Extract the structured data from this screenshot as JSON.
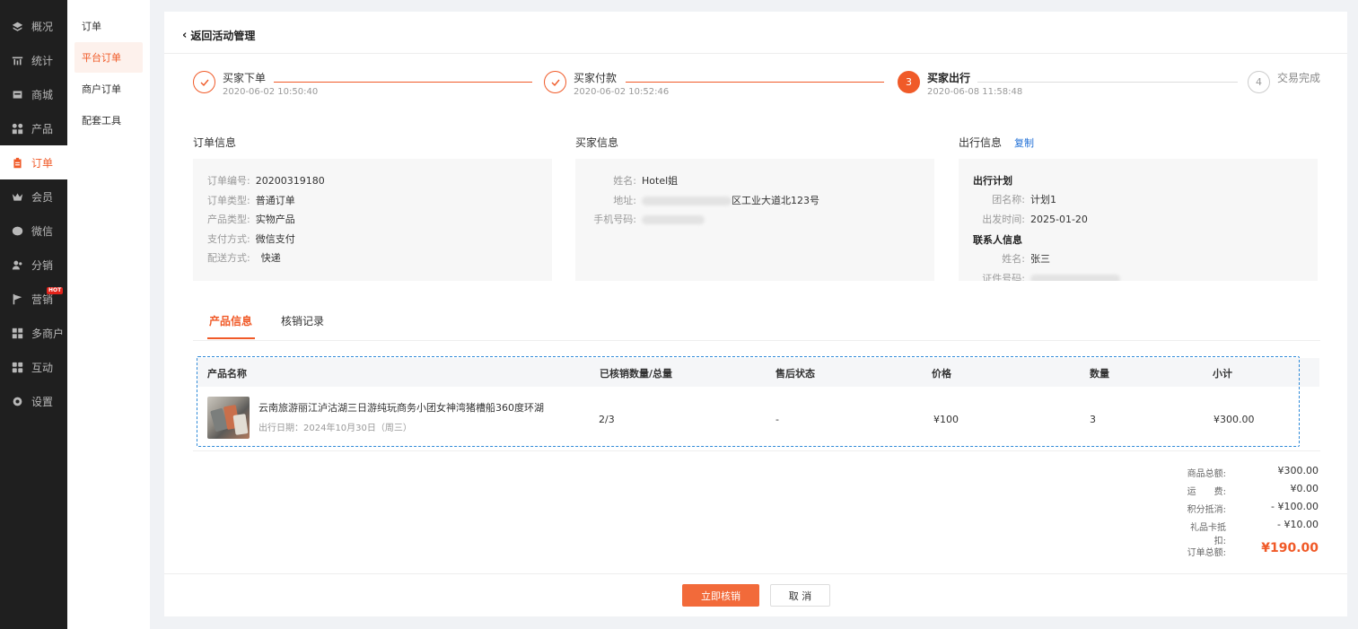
{
  "nav": [
    {
      "label": "概况",
      "icon": "layers-icon"
    },
    {
      "label": "统计",
      "icon": "chart-icon"
    },
    {
      "label": "商城",
      "icon": "store-icon"
    },
    {
      "label": "产品",
      "icon": "grid-icon"
    },
    {
      "label": "订单",
      "icon": "clipboard-icon",
      "active": true
    },
    {
      "label": "会员",
      "icon": "crown-icon"
    },
    {
      "label": "微信",
      "icon": "wechat-icon"
    },
    {
      "label": "分销",
      "icon": "users-icon"
    },
    {
      "label": "营销",
      "icon": "flag-icon",
      "badge": "HOT"
    },
    {
      "label": "多商户",
      "icon": "shop-icon"
    },
    {
      "label": "互动",
      "icon": "apps-icon"
    },
    {
      "label": "设置",
      "icon": "gear-icon"
    }
  ],
  "subnav": [
    {
      "label": "订单"
    },
    {
      "label": "平台订单",
      "active": true
    },
    {
      "label": "商户订单"
    },
    {
      "label": "配套工具"
    }
  ],
  "back_label": "返回活动管理",
  "steps": [
    {
      "title": "买家下单",
      "time": "2020-06-02 10:50:40"
    },
    {
      "title": "买家付款",
      "time": "2020-06-02 10:52:46"
    },
    {
      "num": "3",
      "title": "买家出行",
      "time": "2020-06-08 11:58:48"
    },
    {
      "num": "4",
      "title": "交易完成",
      "time": ""
    }
  ],
  "order_info": {
    "title": "订单信息",
    "rows": [
      {
        "k": "订单编号:",
        "v": "20200319180"
      },
      {
        "k": "订单类型:",
        "v": "普通订单"
      },
      {
        "k": "产品类型:",
        "v": "实物产品"
      },
      {
        "k": "支付方式:",
        "v": "微信支付"
      },
      {
        "k": "配送方式:",
        "v": "快递"
      }
    ]
  },
  "buyer_info": {
    "title": "买家信息",
    "name_k": "姓名:",
    "name_v": "Hotel姐",
    "addr_k": "地址:",
    "addr_v": "区工业大道北123号",
    "phone_k": "手机号码:"
  },
  "travel_info": {
    "title": "出行信息",
    "copy": "复制",
    "plan_head": "出行计划",
    "group_k": "团名称:",
    "group_v": "计划1",
    "depart_k": "出发时间:",
    "depart_v": "2025-01-20",
    "contact_head": "联系人信息",
    "cname_k": "姓名:",
    "cname_v": "张三",
    "idno_k": "证件号码:"
  },
  "tabs": [
    "产品信息",
    "核销记录"
  ],
  "table": {
    "headers": [
      "产品名称",
      "已核销数量/总量",
      "售后状态",
      "价格",
      "数量",
      "小计"
    ],
    "row": {
      "name": "云南旅游丽江泸沽湖三日游纯玩商务小团女神湾猪槽船360度环湖",
      "date": "出行日期：2024年10月30日（周三）",
      "verified": "2/3",
      "aftersale": "-",
      "price": "¥100",
      "qty": "3",
      "subtotal": "¥300.00"
    }
  },
  "totals": [
    {
      "k": "商品总额:",
      "v": "¥300.00"
    },
    {
      "k": "运　　费:",
      "v": "¥0.00"
    },
    {
      "k": "积分抵消:",
      "v": "- ¥100.00"
    },
    {
      "k": "礼品卡抵扣:",
      "v": "- ¥10.00"
    }
  ],
  "grand_total": {
    "k": "订单总额:",
    "v": "¥190.00"
  },
  "buttons": {
    "primary": "立即核销",
    "cancel": "取 消"
  },
  "colors": {
    "accent": "#f05a28",
    "link": "#1f6fd6",
    "nav_bg": "#1f1f1f"
  }
}
